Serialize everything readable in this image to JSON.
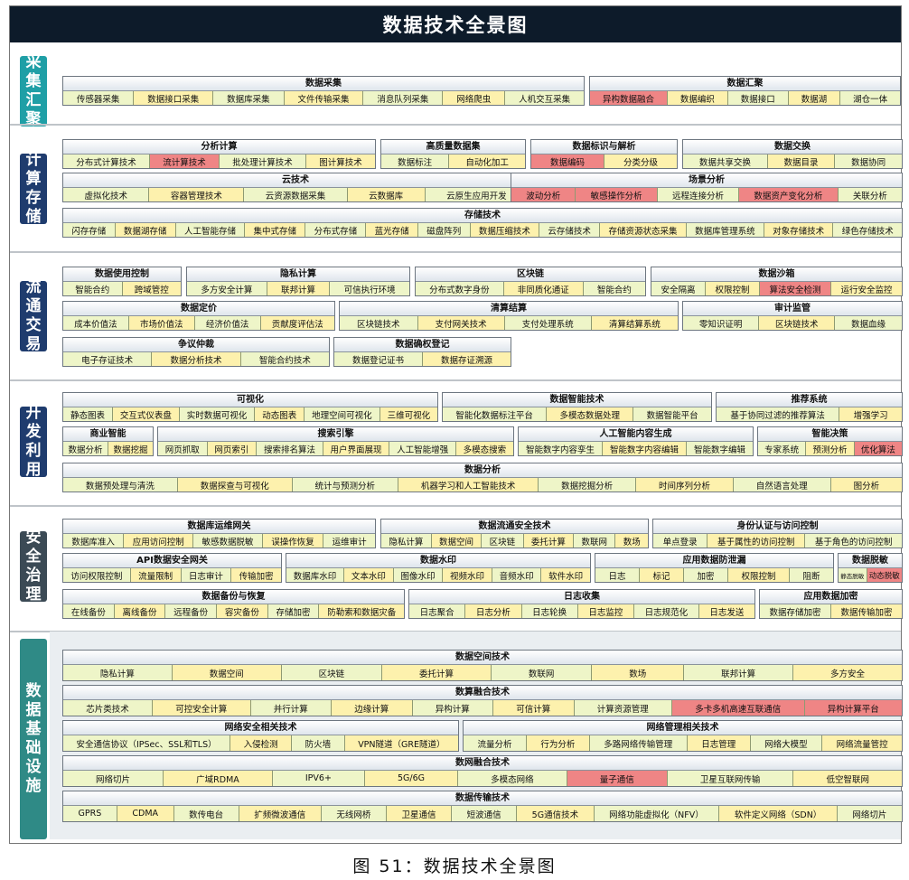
{
  "title": "数据技术全景图",
  "caption": "图 51：数据技术全景图",
  "colors": {
    "title_bg": "#0d1b2a",
    "sidebar_teal": "#1f9fa6",
    "sidebar_navy": "#1f3c6e",
    "sidebar_dark": "#3b4a55",
    "sidebar_infra": "#2f8a86",
    "cell_green": "#eef5c8",
    "cell_yellow": "#fdf1ad",
    "highlight_red": "#ef8585"
  },
  "sections": [
    {
      "name": "采集汇聚",
      "color": "#1f9fa6",
      "blocks": [
        {
          "title": "数据采集",
          "items": [
            {
              "t": "传感器采集"
            },
            {
              "t": "数据接口采集"
            },
            {
              "t": "数据库采集"
            },
            {
              "t": "文件传输采集"
            },
            {
              "t": "消息队列采集"
            },
            {
              "t": "网络爬虫"
            },
            {
              "t": "人机交互采集"
            }
          ]
        },
        {
          "title": "数据汇聚",
          "items": [
            {
              "t": "异构数据融合",
              "h": 1
            },
            {
              "t": "数据编织"
            },
            {
              "t": "数据接口"
            },
            {
              "t": "数据湖"
            },
            {
              "t": "湖仓一体"
            }
          ]
        }
      ]
    },
    {
      "name": "计算存储",
      "color": "#1f3c6e",
      "blocks": [
        {
          "title": "分析计算",
          "items": [
            {
              "t": "分布式计算技术"
            },
            {
              "t": "流计算技术",
              "h": 1
            },
            {
              "t": "批处理计算技术"
            },
            {
              "t": "图计算技术"
            }
          ]
        },
        {
          "title": "高质量数据集",
          "items": [
            {
              "t": "数据标注"
            },
            {
              "t": "自动化加工"
            }
          ]
        },
        {
          "title": "数据标识与解析",
          "items": [
            {
              "t": "数据编码",
              "h": 1
            },
            {
              "t": "分类分级"
            }
          ]
        },
        {
          "title": "数据交换",
          "items": [
            {
              "t": "数据共享交换"
            },
            {
              "t": "数据目录"
            },
            {
              "t": "数据协同"
            }
          ]
        },
        {
          "title": "云技术",
          "items": [
            {
              "t": "虚拟化技术"
            },
            {
              "t": "容器管理技术"
            },
            {
              "t": "云资源数据采集"
            },
            {
              "t": "云数据库"
            },
            {
              "t": "云原生应用开发"
            }
          ]
        },
        {
          "title": "场景分析",
          "items": [
            {
              "t": "波动分析",
              "h": 1
            },
            {
              "t": "敏感操作分析",
              "h": 1
            },
            {
              "t": "远程连接分析"
            },
            {
              "t": "数据资产变化分析",
              "h": 1
            },
            {
              "t": "关联分析"
            }
          ]
        },
        {
          "title": "存储技术",
          "items": [
            {
              "t": "闪存存储"
            },
            {
              "t": "数据湖存储"
            },
            {
              "t": "人工智能存储"
            },
            {
              "t": "集中式存储"
            },
            {
              "t": "分布式存储"
            },
            {
              "t": "蓝光存储"
            },
            {
              "t": "磁盘阵列"
            },
            {
              "t": "数据压缩技术"
            },
            {
              "t": "云存储技术"
            },
            {
              "t": "存储资源状态采集"
            },
            {
              "t": "数据库管理系统"
            },
            {
              "t": "对象存储技术"
            },
            {
              "t": "绿色存储技术"
            }
          ]
        }
      ]
    },
    {
      "name": "流通交易",
      "color": "#1f3c6e",
      "blocks": [
        {
          "title": "数据使用控制",
          "items": [
            {
              "t": "智能合约"
            },
            {
              "t": "跨域管控"
            }
          ]
        },
        {
          "title": "隐私计算",
          "items": [
            {
              "t": "多方安全计算"
            },
            {
              "t": "联邦计算"
            },
            {
              "t": "可信执行环境"
            }
          ]
        },
        {
          "title": "区块链",
          "items": [
            {
              "t": "分布式数字身份"
            },
            {
              "t": "非同质化通证"
            },
            {
              "t": "智能合约"
            }
          ]
        },
        {
          "title": "数据沙箱",
          "items": [
            {
              "t": "安全隔离"
            },
            {
              "t": "权限控制"
            },
            {
              "t": "算法安全检测",
              "h": 1
            },
            {
              "t": "运行安全监控"
            }
          ]
        },
        {
          "title": "数据定价",
          "items": [
            {
              "t": "成本价值法"
            },
            {
              "t": "市场价值法"
            },
            {
              "t": "经济价值法"
            },
            {
              "t": "贡献度评估法"
            }
          ]
        },
        {
          "title": "清算结算",
          "items": [
            {
              "t": "区块链技术"
            },
            {
              "t": "支付网关技术"
            },
            {
              "t": "支付处理系统"
            },
            {
              "t": "清算结算系统"
            }
          ]
        },
        {
          "title": "审计监管",
          "items": [
            {
              "t": "零知识证明"
            },
            {
              "t": "区块链技术"
            },
            {
              "t": "数据血缘"
            }
          ]
        },
        {
          "title": "争议仲裁",
          "items": [
            {
              "t": "电子存证技术"
            },
            {
              "t": "数据分析技术"
            },
            {
              "t": "智能合约技术"
            }
          ]
        },
        {
          "title": "数据确权登记",
          "items": [
            {
              "t": "数据登记证书"
            },
            {
              "t": "数据存证溯源"
            }
          ]
        }
      ]
    },
    {
      "name": "开发利用",
      "color": "#1f3c6e",
      "blocks": [
        {
          "title": "可视化",
          "items": [
            {
              "t": "静态图表"
            },
            {
              "t": "交互式仪表盘"
            },
            {
              "t": "实时数据可视化"
            },
            {
              "t": "动态图表"
            },
            {
              "t": "地理空间可视化"
            },
            {
              "t": "三维可视化"
            }
          ]
        },
        {
          "title": "数据智能技术",
          "items": [
            {
              "t": "智能化数据标注平台"
            },
            {
              "t": "多模态数据处理"
            },
            {
              "t": "数据智能平台"
            }
          ]
        },
        {
          "title": "推荐系统",
          "items": [
            {
              "t": "基于协同过滤的推荐算法"
            },
            {
              "t": "增强学习"
            }
          ]
        },
        {
          "title": "商业智能",
          "items": [
            {
              "t": "数据分析"
            },
            {
              "t": "数据挖掘"
            }
          ]
        },
        {
          "title": "搜索引擎",
          "items": [
            {
              "t": "网页抓取"
            },
            {
              "t": "网页索引"
            },
            {
              "t": "搜索排名算法"
            },
            {
              "t": "用户界面展现"
            },
            {
              "t": "人工智能增强"
            },
            {
              "t": "多模态搜索"
            }
          ]
        },
        {
          "title": "人工智能内容生成",
          "items": [
            {
              "t": "智能数字内容孪生"
            },
            {
              "t": "智能数字内容编辑"
            },
            {
              "t": "智能数字编辑"
            }
          ]
        },
        {
          "title": "智能决策",
          "items": [
            {
              "t": "专家系统"
            },
            {
              "t": "预测分析"
            },
            {
              "t": "优化算法",
              "h": 1
            }
          ]
        },
        {
          "title": "数据分析",
          "items": [
            {
              "t": "数据预处理与清洗"
            },
            {
              "t": "数据探查与可视化"
            },
            {
              "t": "统计与预测分析"
            },
            {
              "t": "机器学习和人工智能技术"
            },
            {
              "t": "数据挖掘分析"
            },
            {
              "t": "时间序列分析"
            },
            {
              "t": "自然语言处理"
            },
            {
              "t": "图分析"
            }
          ]
        }
      ]
    },
    {
      "name": "安全治理",
      "color": "#3b4a55",
      "blocks": [
        {
          "title": "数据库运维网关",
          "items": [
            {
              "t": "数据库准入"
            },
            {
              "t": "应用访问控制"
            },
            {
              "t": "敏感数据脱敏"
            },
            {
              "t": "误操作恢复"
            },
            {
              "t": "运维审计"
            }
          ]
        },
        {
          "title": "数据流通安全技术",
          "items": [
            {
              "t": "隐私计算"
            },
            {
              "t": "数据空间"
            },
            {
              "t": "区块链"
            },
            {
              "t": "委托计算"
            },
            {
              "t": "数联网"
            },
            {
              "t": "数场"
            }
          ]
        },
        {
          "title": "身份认证与访问控制",
          "items": [
            {
              "t": "单点登录"
            },
            {
              "t": "基于属性的访问控制"
            },
            {
              "t": "基于角色的访问控制"
            }
          ]
        },
        {
          "title": "API数据安全网关",
          "items": [
            {
              "t": "访问权限控制"
            },
            {
              "t": "流量限制"
            },
            {
              "t": "日志审计"
            },
            {
              "t": "传输加密"
            }
          ]
        },
        {
          "title": "数据水印",
          "items": [
            {
              "t": "数据库水印"
            },
            {
              "t": "文本水印"
            },
            {
              "t": "图像水印"
            },
            {
              "t": "视频水印"
            },
            {
              "t": "音频水印"
            },
            {
              "t": "软件水印"
            }
          ]
        },
        {
          "title": "应用数据防泄漏",
          "items": [
            {
              "t": "日志"
            },
            {
              "t": "标记"
            },
            {
              "t": "加密"
            },
            {
              "t": "权限控制"
            },
            {
              "t": "阻断"
            }
          ]
        },
        {
          "title": "数据脱敏",
          "items": [
            {
              "t": "静态脱敏"
            },
            {
              "t": "动态脱敏",
              "h": 1
            }
          ]
        },
        {
          "title": "数据备份与恢复",
          "items": [
            {
              "t": "在线备份"
            },
            {
              "t": "离线备份"
            },
            {
              "t": "远程备份"
            },
            {
              "t": "容灾备份"
            },
            {
              "t": "存储加密"
            },
            {
              "t": "防勒索和数据灾备"
            }
          ]
        },
        {
          "title": "日志收集",
          "items": [
            {
              "t": "日志聚合"
            },
            {
              "t": "日志分析"
            },
            {
              "t": "日志轮换"
            },
            {
              "t": "日志监控"
            },
            {
              "t": "日志规范化"
            },
            {
              "t": "日志发送"
            }
          ]
        },
        {
          "title": "应用数据加密",
          "items": [
            {
              "t": "数据存储加密"
            },
            {
              "t": "数据传输加密"
            }
          ]
        }
      ]
    },
    {
      "name": "数据基础设施",
      "color": "#2f8a86",
      "blocks": [
        {
          "title": "数据空间技术",
          "items": [
            {
              "t": "隐私计算"
            },
            {
              "t": "数据空间"
            },
            {
              "t": "区块链"
            },
            {
              "t": "委托计算"
            },
            {
              "t": "数联网"
            },
            {
              "t": "数场"
            },
            {
              "t": "联邦计算"
            },
            {
              "t": "多方安全"
            }
          ]
        },
        {
          "title": "数算融合技术",
          "items": [
            {
              "t": "芯片类技术"
            },
            {
              "t": "可控安全计算"
            },
            {
              "t": "并行计算"
            },
            {
              "t": "边缘计算"
            },
            {
              "t": "异构计算"
            },
            {
              "t": "可信计算"
            },
            {
              "t": "计算资源管理"
            },
            {
              "t": "多卡多机高速互联通信",
              "h": 1
            },
            {
              "t": "异构计算平台",
              "h": 1
            }
          ]
        },
        {
          "title": "网络安全相关技术",
          "items": [
            {
              "t": "安全通信协议（IPSec、SSL和TLS）"
            },
            {
              "t": "入侵检测"
            },
            {
              "t": "防火墙"
            },
            {
              "t": "VPN隧道（GRE隧道）"
            }
          ]
        },
        {
          "title": "网络管理相关技术",
          "items": [
            {
              "t": "流量分析"
            },
            {
              "t": "行为分析"
            },
            {
              "t": "多路网络传输管理"
            },
            {
              "t": "日志管理"
            },
            {
              "t": "网络大模型"
            },
            {
              "t": "网络流量管控"
            }
          ]
        },
        {
          "title": "数网融合技术",
          "items": [
            {
              "t": "网络切片"
            },
            {
              "t": "广域RDMA"
            },
            {
              "t": "IPV6+"
            },
            {
              "t": "5G/6G"
            },
            {
              "t": "多模态网络"
            },
            {
              "t": "量子通信",
              "h": 1
            },
            {
              "t": "卫星互联网传输"
            },
            {
              "t": "低空智联网"
            }
          ]
        },
        {
          "title": "数据传输技术",
          "items": [
            {
              "t": "GPRS"
            },
            {
              "t": "CDMA"
            },
            {
              "t": "数传电台"
            },
            {
              "t": "扩频微波通信"
            },
            {
              "t": "无线网桥"
            },
            {
              "t": "卫星通信"
            },
            {
              "t": "短波通信"
            },
            {
              "t": "5G通信技术"
            },
            {
              "t": "网络功能虚拟化（NFV）"
            },
            {
              "t": "软件定义网络（SDN）"
            },
            {
              "t": "网络切片"
            }
          ]
        }
      ]
    }
  ]
}
